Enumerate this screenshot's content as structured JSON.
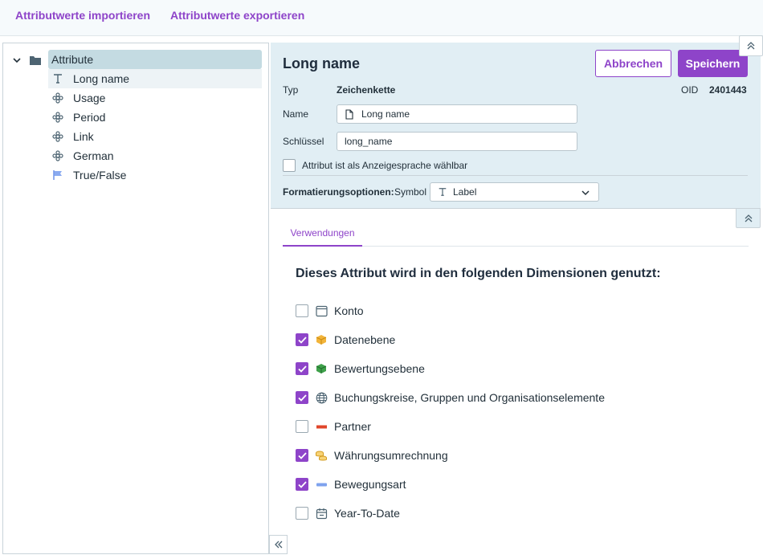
{
  "toolbar": {
    "import_label": "Attributwerte importieren",
    "export_label": "Attributwerte exportieren"
  },
  "tree": {
    "root_label": "Attribute",
    "items": [
      {
        "label": "Long name",
        "icon": "text-type-icon"
      },
      {
        "label": "Usage",
        "icon": "flower-icon"
      },
      {
        "label": "Period",
        "icon": "flower-icon"
      },
      {
        "label": "Link",
        "icon": "flower-icon"
      },
      {
        "label": "German",
        "icon": "flower-icon"
      },
      {
        "label": "True/False",
        "icon": "flag-icon"
      }
    ]
  },
  "detail": {
    "title": "Long name",
    "cancel_label": "Abbrechen",
    "save_label": "Speichern",
    "type_label": "Typ",
    "type_value": "Zeichenkette",
    "oid_label": "OID",
    "oid_value": "2401443",
    "name_label": "Name",
    "name_value": "Long name",
    "key_label": "Schlüssel",
    "key_value": "long_name",
    "checkbox_label": "Attribut ist als Anzeigesprache wählbar",
    "format_label": "Formatierungsoptionen:",
    "symbol_label": "Symbol",
    "symbol_value": "Label"
  },
  "usage": {
    "tab_label": "Verwendungen",
    "heading": "Dieses Attribut wird in den folgenden Dimensionen genutzt:",
    "items": [
      {
        "label": "Konto",
        "checked": false,
        "icon": "window-icon"
      },
      {
        "label": "Datenebene",
        "checked": true,
        "icon": "cube-orange-icon"
      },
      {
        "label": "Bewertungsebene",
        "checked": true,
        "icon": "cube-green-icon"
      },
      {
        "label": "Buchungskreise, Gruppen und Organisationselemente",
        "checked": true,
        "icon": "globe-icon"
      },
      {
        "label": "Partner",
        "checked": false,
        "icon": "red-bar-icon"
      },
      {
        "label": "Währungsumrechnung",
        "checked": true,
        "icon": "coins-icon"
      },
      {
        "label": "Bewegungsart",
        "checked": true,
        "icon": "blue-bar-icon"
      },
      {
        "label": "Year-To-Date",
        "checked": false,
        "icon": "calendar-icon"
      }
    ]
  },
  "colors": {
    "accent": "#8e44c9",
    "panel_bg": "#e1eef4",
    "tree_selected": "#c4dbe2"
  }
}
